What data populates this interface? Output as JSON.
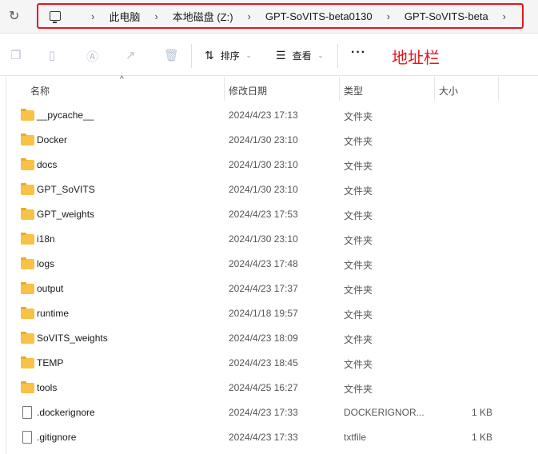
{
  "address": {
    "crumbs": [
      "此电脑",
      "本地磁盘 (Z:)",
      "GPT-SoVITS-beta0130",
      "GPT-SoVITS-beta"
    ]
  },
  "toolbar": {
    "sort_label": "排序",
    "view_label": "查看",
    "more_label": "···"
  },
  "annotation": "地址栏",
  "columns": {
    "name": "名称",
    "date": "修改日期",
    "type": "类型",
    "size": "大小"
  },
  "files": [
    {
      "name": "__pycache__",
      "date": "2024/4/23 17:13",
      "type": "文件夹",
      "size": "",
      "kind": "folder"
    },
    {
      "name": "Docker",
      "date": "2024/1/30 23:10",
      "type": "文件夹",
      "size": "",
      "kind": "folder"
    },
    {
      "name": "docs",
      "date": "2024/1/30 23:10",
      "type": "文件夹",
      "size": "",
      "kind": "folder"
    },
    {
      "name": "GPT_SoVITS",
      "date": "2024/1/30 23:10",
      "type": "文件夹",
      "size": "",
      "kind": "folder"
    },
    {
      "name": "GPT_weights",
      "date": "2024/4/23 17:53",
      "type": "文件夹",
      "size": "",
      "kind": "folder"
    },
    {
      "name": "i18n",
      "date": "2024/1/30 23:10",
      "type": "文件夹",
      "size": "",
      "kind": "folder"
    },
    {
      "name": "logs",
      "date": "2024/4/23 17:48",
      "type": "文件夹",
      "size": "",
      "kind": "folder"
    },
    {
      "name": "output",
      "date": "2024/4/23 17:37",
      "type": "文件夹",
      "size": "",
      "kind": "folder"
    },
    {
      "name": "runtime",
      "date": "2024/1/18 19:57",
      "type": "文件夹",
      "size": "",
      "kind": "folder"
    },
    {
      "name": "SoVITS_weights",
      "date": "2024/4/23 18:09",
      "type": "文件夹",
      "size": "",
      "kind": "folder"
    },
    {
      "name": "TEMP",
      "date": "2024/4/23 18:45",
      "type": "文件夹",
      "size": "",
      "kind": "folder"
    },
    {
      "name": "tools",
      "date": "2024/4/25 16:27",
      "type": "文件夹",
      "size": "",
      "kind": "folder"
    },
    {
      "name": ".dockerignore",
      "date": "2024/4/23 17:33",
      "type": "DOCKERIGNOR...",
      "size": "1 KB",
      "kind": "file"
    },
    {
      "name": ".gitignore",
      "date": "2024/4/23 17:33",
      "type": "txtfile",
      "size": "1 KB",
      "kind": "file"
    }
  ]
}
